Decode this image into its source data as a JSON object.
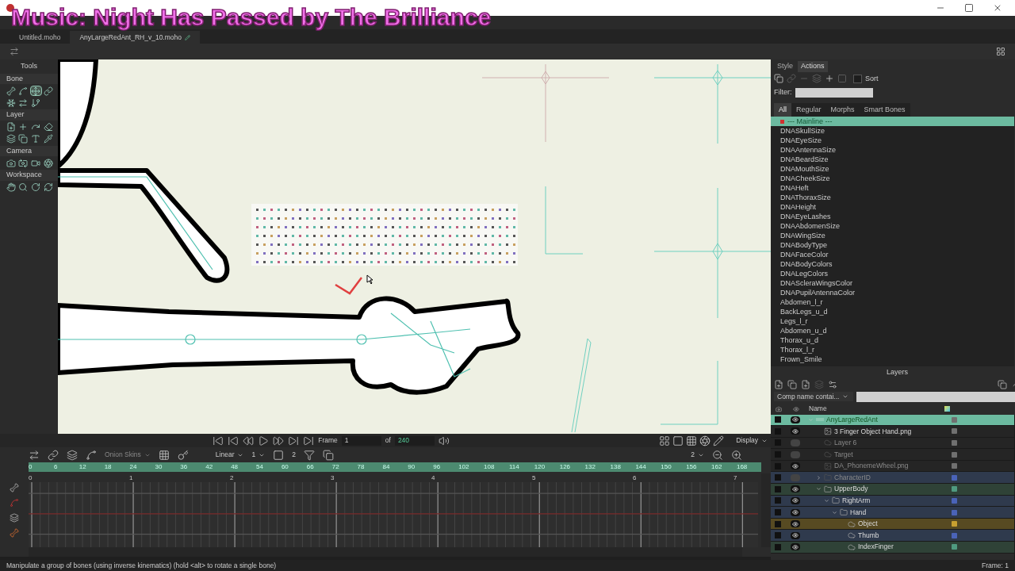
{
  "caption": "Music: Night Has Passed by The Brilliance",
  "document_tabs": [
    {
      "label": "Untitled.moho",
      "selected": false,
      "modified": false
    },
    {
      "label": "AnyLargeRedAnt_RH_v_10.moho",
      "selected": true,
      "modified": true
    }
  ],
  "tools": {
    "title": "Tools",
    "sections": [
      {
        "title": "Bone",
        "tools": [
          {
            "selected": false
          },
          {
            "selected": false
          },
          {
            "selected": true
          },
          {
            "selected": false
          },
          {
            "selected": false
          },
          {
            "selected": false
          },
          {
            "selected": false
          }
        ]
      },
      {
        "title": "Layer",
        "tools": [
          {
            "selected": false
          },
          {
            "selected": false
          },
          {
            "selected": false
          },
          {
            "selected": false
          },
          {
            "selected": false
          },
          {
            "selected": false
          },
          {
            "selected": false
          },
          {
            "selected": false
          }
        ]
      },
      {
        "title": "Camera",
        "tools": [
          {
            "selected": false
          },
          {
            "selected": false
          },
          {
            "selected": false
          },
          {
            "selected": false
          }
        ]
      },
      {
        "title": "Workspace",
        "tools": [
          {
            "selected": false
          },
          {
            "selected": false
          },
          {
            "selected": false
          },
          {
            "selected": false
          }
        ]
      }
    ]
  },
  "playback": {
    "frame_label": "Frame",
    "frame": "1",
    "of_label": "of",
    "total": "240",
    "display": "Display"
  },
  "timeline": {
    "onion_skins": "Onion Skins",
    "interpolation": "Linear",
    "interp_value": "1",
    "key_value": "2",
    "zoom_value": "2",
    "frame_ticks": [
      "0",
      "6",
      "12",
      "18",
      "24",
      "30",
      "36",
      "42",
      "48",
      "54",
      "60",
      "66",
      "72",
      "78",
      "84",
      "90",
      "96",
      "102",
      "108",
      "114",
      "120",
      "126",
      "132",
      "138",
      "144",
      "150",
      "156",
      "162",
      "168"
    ],
    "second_ticks": [
      "0",
      "1",
      "2",
      "3",
      "4",
      "5",
      "6",
      "7"
    ]
  },
  "status_bar": {
    "message": "Manipulate a group of bones (using inverse kinematics) (hold <alt> to rotate a single bone)",
    "frame": "Frame: 1"
  },
  "panel_tabs": [
    {
      "label": "Style",
      "selected": false
    },
    {
      "label": "Actions",
      "selected": true
    }
  ],
  "actions": {
    "sort_label": "Sort",
    "sort_checked": false,
    "filter_label": "Filter:",
    "filter_tabs": [
      {
        "label": "All",
        "selected": true
      },
      {
        "label": "Regular",
        "selected": false
      },
      {
        "label": "Morphs",
        "selected": false
      },
      {
        "label": "Smart Bones",
        "selected": false
      }
    ],
    "items": [
      {
        "label": "--- Mainline ---",
        "selected": true
      },
      {
        "label": "DNASkullSize",
        "selected": false
      },
      {
        "label": "DNAEyeSize",
        "selected": false
      },
      {
        "label": "DNAAntennaSize",
        "selected": false
      },
      {
        "label": "DNABeardSize",
        "selected": false
      },
      {
        "label": "DNAMouthSize",
        "selected": false
      },
      {
        "label": "DNACheekSize",
        "selected": false
      },
      {
        "label": "DNAHeft",
        "selected": false
      },
      {
        "label": "DNAThoraxSize",
        "selected": false
      },
      {
        "label": "DNAHeight",
        "selected": false
      },
      {
        "label": "DNAEyeLashes",
        "selected": false
      },
      {
        "label": "DNAAbdomenSize",
        "selected": false
      },
      {
        "label": "DNAWingSize",
        "selected": false
      },
      {
        "label": "DNABodyType",
        "selected": false
      },
      {
        "label": "DNAFaceColor",
        "selected": false
      },
      {
        "label": "DNABodyColors",
        "selected": false
      },
      {
        "label": "DNALegColors",
        "selected": false
      },
      {
        "label": "DNAScleraWingsColor",
        "selected": false
      },
      {
        "label": "DNAPupilAntennaColor",
        "selected": false
      },
      {
        "label": "Abdomen_l_r",
        "selected": false
      },
      {
        "label": "BackLegs_u_d",
        "selected": false
      },
      {
        "label": "Legs_l_r",
        "selected": false
      },
      {
        "label": "Abdomen_u_d",
        "selected": false
      },
      {
        "label": "Thorax_u_d",
        "selected": false
      },
      {
        "label": "Thorax_l_r",
        "selected": false
      },
      {
        "label": "Frown_Smile",
        "selected": false
      }
    ]
  },
  "layers": {
    "title": "Layers",
    "filter": "Comp name contai...",
    "name_column": "Name",
    "items": [
      {
        "name": "AnyLargeRedAnt",
        "kind": "group",
        "selected": true,
        "visible": true,
        "dimmed": false,
        "expanded": true,
        "color": "#707070",
        "children": [
          {
            "name": "3 Finger Object Hand.png",
            "kind": "image",
            "selected": false,
            "visible": true,
            "dimmed": false,
            "color": "#707070"
          },
          {
            "name": "Layer 6",
            "kind": "vector",
            "selected": false,
            "visible": false,
            "dimmed": true,
            "color": "#707070"
          },
          {
            "name": "Target",
            "kind": "vector",
            "selected": false,
            "visible": false,
            "dimmed": true,
            "color": "#707070"
          },
          {
            "name": "DA_PhonemeWheel.png",
            "kind": "image",
            "selected": false,
            "visible": true,
            "dimmed": true,
            "color": "#707070"
          },
          {
            "name": "CharacterID",
            "kind": "folder",
            "selected": false,
            "visible": false,
            "dimmed": true,
            "expanded": false,
            "color": "#4a63b8"
          },
          {
            "name": "UpperBody",
            "kind": "folder",
            "selected": false,
            "visible": true,
            "dimmed": false,
            "expanded": true,
            "color": "#4f9a80",
            "children": [
              {
                "name": "RightArm",
                "kind": "folder",
                "selected": false,
                "visible": true,
                "dimmed": false,
                "expanded": true,
                "color": "#4a63b8",
                "children": [
                  {
                    "name": "Hand",
                    "kind": "folder",
                    "selected": false,
                    "visible": true,
                    "dimmed": false,
                    "expanded": true,
                    "color": "#4a63b8",
                    "children": [
                      {
                        "name": "Object",
                        "kind": "vector",
                        "selected": false,
                        "visible": true,
                        "dimmed": false,
                        "color": "#c8a030"
                      },
                      {
                        "name": "Thumb",
                        "kind": "vector",
                        "selected": false,
                        "visible": true,
                        "dimmed": false,
                        "color": "#4a63b8"
                      },
                      {
                        "name": "IndexFinger",
                        "kind": "vector",
                        "selected": false,
                        "visible": true,
                        "dimmed": false,
                        "color": "#4f9a80"
                      }
                    ]
                  }
                ]
              }
            ]
          }
        ]
      }
    ]
  }
}
